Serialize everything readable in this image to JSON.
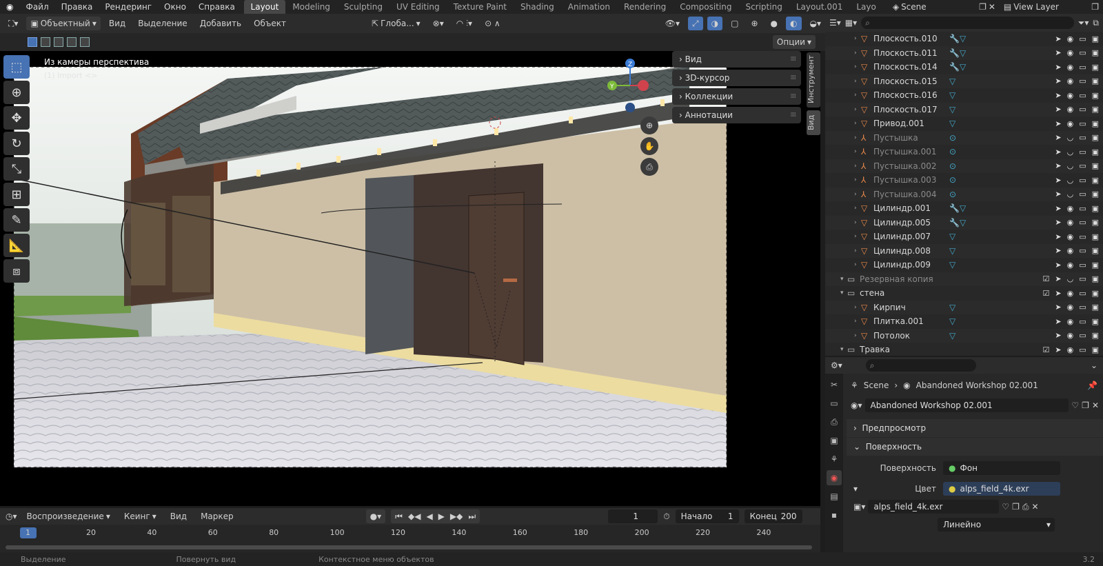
{
  "topbar": {
    "menus": [
      "Файл",
      "Правка",
      "Рендеринг",
      "Окно",
      "Справка"
    ],
    "tabs": [
      "Layout",
      "Modeling",
      "Sculpting",
      "UV Editing",
      "Texture Paint",
      "Shading",
      "Animation",
      "Rendering",
      "Compositing",
      "Scripting",
      "Layout.001",
      "Layo"
    ],
    "scene": "Scene",
    "view_layer": "View Layer"
  },
  "vp_header": {
    "mode": "Объектный",
    "menus": [
      "Вид",
      "Выделение",
      "Добавить",
      "Объект"
    ],
    "orientation": "Глоба...",
    "options": "Опции"
  },
  "viewport": {
    "camera_label": "Из камеры перспектива",
    "sub_label": "(1) Import <>"
  },
  "npanel": {
    "items": [
      "Вид",
      "3D-курсор",
      "Коллекции",
      "Аннотации"
    ],
    "tabs": [
      "Инструмент",
      "Вид"
    ]
  },
  "outliner": {
    "rows": [
      {
        "name": "Плоскость.010",
        "dim": false,
        "mods": "🔧▽",
        "indent": 2
      },
      {
        "name": "Плоскость.011",
        "dim": false,
        "mods": "🔧▽",
        "indent": 2
      },
      {
        "name": "Плоскость.014",
        "dim": false,
        "mods": "🔧▽",
        "indent": 2
      },
      {
        "name": "Плоскость.015",
        "dim": false,
        "mods": "▽",
        "indent": 2
      },
      {
        "name": "Плоскость.016",
        "dim": false,
        "mods": "▽",
        "indent": 2
      },
      {
        "name": "Плоскость.017",
        "dim": false,
        "mods": "▽",
        "indent": 2
      },
      {
        "name": "Привод.001",
        "dim": false,
        "mods": "▽",
        "indent": 2
      },
      {
        "name": "Пустышка",
        "dim": true,
        "mods": "⊙",
        "indent": 2
      },
      {
        "name": "Пустышка.001",
        "dim": true,
        "mods": "⊙",
        "indent": 2
      },
      {
        "name": "Пустышка.002",
        "dim": true,
        "mods": "⊙",
        "indent": 2
      },
      {
        "name": "Пустышка.003",
        "dim": true,
        "mods": "⊙",
        "indent": 2
      },
      {
        "name": "Пустышка.004",
        "dim": true,
        "mods": "⊙",
        "indent": 2
      },
      {
        "name": "Цилиндр.001",
        "dim": false,
        "mods": "🔧▽",
        "indent": 2
      },
      {
        "name": "Цилиндр.005",
        "dim": false,
        "mods": "🔧▽",
        "indent": 2
      },
      {
        "name": "Цилиндр.007",
        "dim": false,
        "mods": "▽",
        "indent": 2
      },
      {
        "name": "Цилиндр.008",
        "dim": false,
        "mods": "▽",
        "indent": 2
      },
      {
        "name": "Цилиндр.009",
        "dim": false,
        "mods": "▽",
        "indent": 2
      },
      {
        "name": "Резервная копия",
        "dim": true,
        "mods": "",
        "indent": 1
      },
      {
        "name": "стена",
        "dim": false,
        "mods": "",
        "indent": 1
      },
      {
        "name": "Кирпич",
        "dim": false,
        "mods": "▽",
        "indent": 2
      },
      {
        "name": "Плитка.001",
        "dim": false,
        "mods": "▽",
        "indent": 2
      },
      {
        "name": "Потолок",
        "dim": false,
        "mods": "▽",
        "indent": 2
      },
      {
        "name": "Травка",
        "dim": false,
        "mods": "",
        "indent": 1
      }
    ]
  },
  "props": {
    "breadcrumb_scene": "Scene",
    "breadcrumb_world": "Abandoned Workshop 02.001",
    "world_name": "Abandoned Workshop 02.001",
    "panel_preview": "Предпросмотр",
    "panel_surface": "Поверхность",
    "surface_label": "Поверхность",
    "surface_value": "Фон",
    "color_label": "Цвет",
    "color_value": "alps_field_4k.exr",
    "image_name": "alps_field_4k.exr",
    "interp": "Линейно"
  },
  "timeline": {
    "menus": [
      "Воспроизведение",
      "Кеинг",
      "Вид",
      "Маркер"
    ],
    "frame": "1",
    "start_label": "Начало",
    "start": "1",
    "end_label": "Конец",
    "end": "200",
    "ticks": [
      "1",
      "20",
      "40",
      "60",
      "80",
      "100",
      "120",
      "140",
      "160",
      "180",
      "200",
      "220",
      "240"
    ]
  },
  "statusbar": {
    "items": [
      "Выделение",
      "Повернуть вид",
      "Контекстное меню объектов"
    ],
    "version": "3.2"
  }
}
